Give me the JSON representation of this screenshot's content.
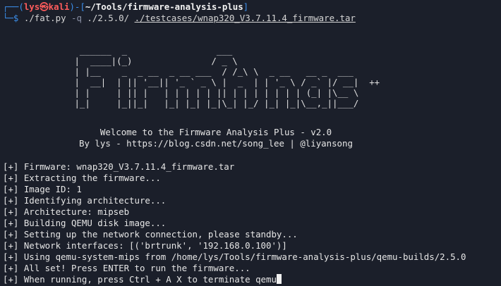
{
  "prompt": {
    "corner_top": "┌──(",
    "user": "lys",
    "skull": "㉿",
    "host": "kali",
    "sep": ")-[",
    "cwd": "~/Tools/firmware-analysis-plus",
    "close": "]",
    "corner_bottom": "└─",
    "dollar": "$",
    "command": "./fat.py",
    "flag": "-q",
    "arg1": "./2.5.0/",
    "arg2": "./testcases/wnap320_V3.7.11.4_firmware.tar"
  },
  "banner": {
    "ascii_art": "  ______  _                 ___\n |  ____|(_)               / _ \\\n | |__    _  _ __  _ __ ___  / /_\\ \\  _ __   __ _  ___\n |  __|  | || '__|| '_ ` _ \\ |  _  | | '_ \\ / _` |/ __|  ++\n | |     | || |   | | | | | || | | | | | | | (_| |\\__ \\\n |_|     |_||_|   |_| |_| |_|\\_| |_/ |_| |_|\\__,_||___/",
    "welcome": "Welcome to the Firmware Analysis Plus - v2.0",
    "byline": "By lys - https://blog.csdn.net/song_lee | @liyansong"
  },
  "log": [
    "[+] Firmware: wnap320_V3.7.11.4_firmware.tar",
    "[+] Extracting the firmware...",
    "[+] Image ID: 1",
    "[+] Identifying architecture...",
    "[+] Architecture: mipseb",
    "[+] Building QEMU disk image...",
    "[+] Setting up the network connection, please standby...",
    "[+] Network interfaces: [('brtrunk', '192.168.0.100')]",
    "[+] Using qemu-system-mips from /home/lys/Tools/firmware-analysis-plus/qemu-builds/2.5.0",
    "[+] All set! Press ENTER to run the firmware...",
    "[+] When running, press Ctrl + A X to terminate qemu"
  ],
  "colors": {
    "background": "#1b1f2a",
    "prompt_frame": "#3b8eea",
    "prompt_user": "#ff5c5c",
    "text": "#e6e6e6"
  }
}
